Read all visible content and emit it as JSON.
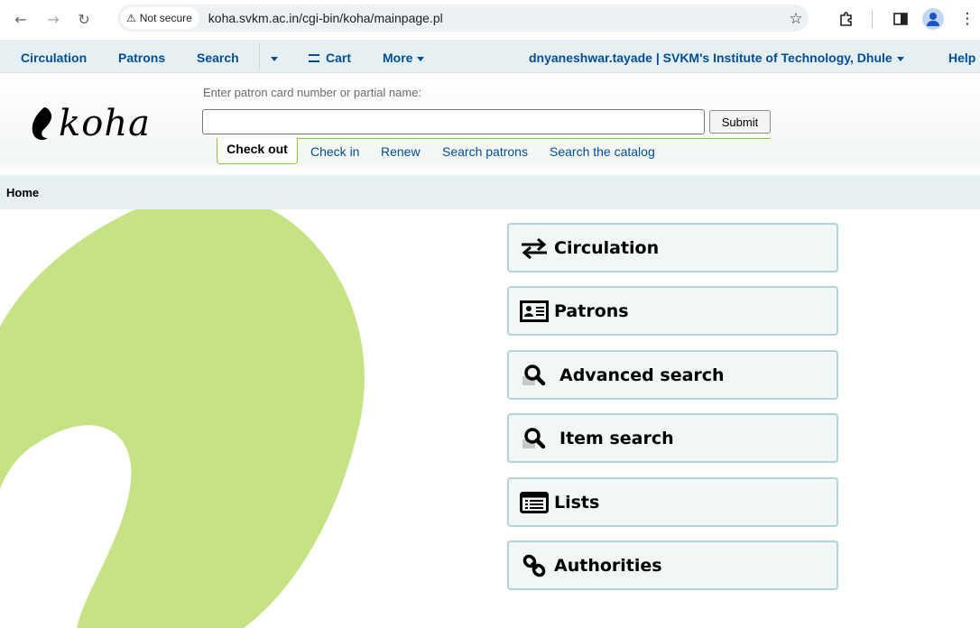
{
  "browser": {
    "security_label": "Not secure",
    "url": "koha.svkm.ac.in/cgi-bin/koha/mainpage.pl"
  },
  "topnav": {
    "circulation": "Circulation",
    "patrons": "Patrons",
    "search": "Search",
    "cart": "Cart",
    "more": "More",
    "user_library": "dnyaneshwar.tayade | SVKM's Institute of Technology, Dhule",
    "help": "Help"
  },
  "header": {
    "logo_text": "koha",
    "prompt": "Enter patron card number or partial name:",
    "input_value": "",
    "submit_label": "Submit",
    "tabs": [
      {
        "label": "Check out",
        "active": true
      },
      {
        "label": "Check in",
        "active": false
      },
      {
        "label": "Renew",
        "active": false
      },
      {
        "label": "Search patrons",
        "active": false
      },
      {
        "label": "Search the catalog",
        "active": false
      }
    ]
  },
  "breadcrumb": {
    "home": "Home"
  },
  "modules": [
    {
      "label": "Circulation",
      "icon": "exchange-icon"
    },
    {
      "label": "Patrons",
      "icon": "id-card-icon"
    },
    {
      "label": "Advanced search",
      "icon": "search-icon"
    },
    {
      "label": "Item search",
      "icon": "search-icon"
    },
    {
      "label": "Lists",
      "icon": "list-icon"
    },
    {
      "label": "Authorities",
      "icon": "link-icon"
    }
  ],
  "colors": {
    "nav_bg": "#e6f0f2",
    "link": "#004d99",
    "koha_green": "#c5e384",
    "module_border": "#b3d4d9"
  }
}
